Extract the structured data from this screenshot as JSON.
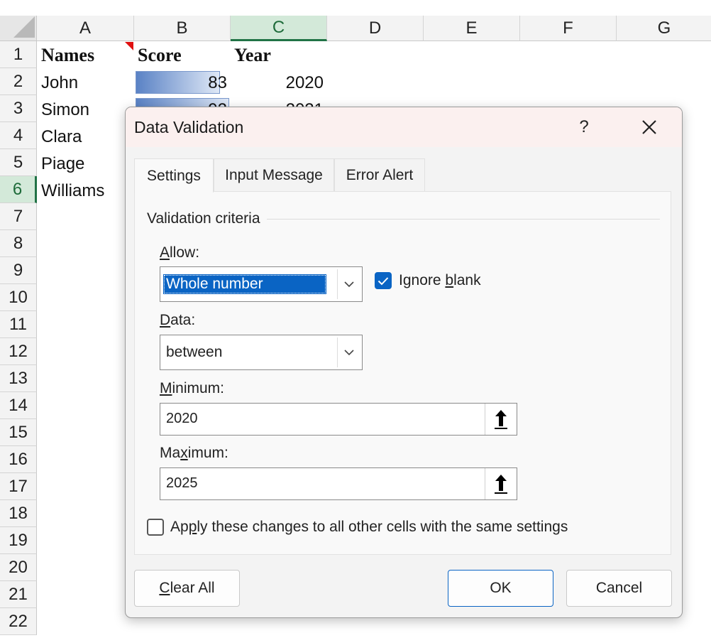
{
  "sheet": {
    "columns": [
      "A",
      "B",
      "C",
      "D",
      "E",
      "F",
      "G"
    ],
    "selected_column": "C",
    "rows": [
      "1",
      "2",
      "3",
      "4",
      "5",
      "6",
      "7",
      "8",
      "9",
      "10",
      "11",
      "12",
      "13",
      "14",
      "15",
      "16",
      "17",
      "18",
      "19",
      "20",
      "21",
      "22"
    ],
    "selected_row": "6",
    "header": {
      "names": "Names",
      "score": "Score",
      "year": "Year"
    },
    "data": [
      {
        "name": "John",
        "score": "83",
        "year": "2020",
        "score_fraction": 0.9
      },
      {
        "name": "Simon",
        "score": "92",
        "year": "2021",
        "score_fraction": 1.0
      },
      {
        "name": "Clara",
        "score": "",
        "year": ""
      },
      {
        "name": "Piage",
        "score": "",
        "year": ""
      },
      {
        "name": "Williams",
        "score": "",
        "year": ""
      }
    ],
    "databar_color": "#5a82c5",
    "comment_indicator_color": "#e01010"
  },
  "dialog": {
    "title": "Data Validation",
    "help": "?",
    "close": "✕",
    "tabs": [
      "Settings",
      "Input Message",
      "Error Alert"
    ],
    "active_tab": "Settings",
    "group_label": "Validation criteria",
    "allow": {
      "label_u": "A",
      "label_rest": "llow:",
      "value": "Whole number"
    },
    "ignore_blank": {
      "label_pre": "Ignore ",
      "label_u": "b",
      "label_rest": "lank",
      "checked": true
    },
    "data": {
      "label_u": "D",
      "label_rest": "ata:",
      "value": "between"
    },
    "minimum": {
      "label_u": "M",
      "label_rest": "inimum:",
      "value": "2020"
    },
    "maximum": {
      "label_pre": "Ma",
      "label_u": "x",
      "label_rest": "imum:",
      "value": "2025"
    },
    "apply": {
      "label_pre": "Ap",
      "label_u": "p",
      "label_rest": "ly these changes to all other cells with the same settings",
      "checked": false
    },
    "buttons": {
      "clear_u": "C",
      "clear_rest": "lear All",
      "ok": "OK",
      "cancel": "Cancel"
    },
    "accent_color": "#0a64c4"
  }
}
